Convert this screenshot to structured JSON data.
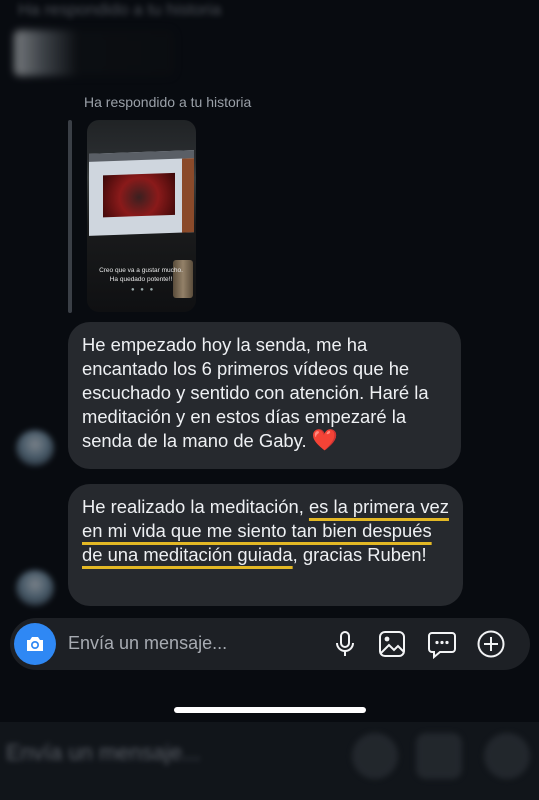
{
  "header": {
    "blurred_text": "Ha respondido a tu historia"
  },
  "reply": {
    "label": "Ha respondido a tu historia",
    "story_caption": "Creo que va a gustar mucho.\nHa quedado potente!!"
  },
  "messages": [
    {
      "id": "msg1",
      "parts": [
        "He empezado hoy la senda, me ha encantado los 6 primeros vídeos que he escuchado y sentido con atención. Haré la meditación y en estos días empezaré la senda de la mano de Gaby. "
      ],
      "emoji": "❤️"
    },
    {
      "id": "msg2",
      "part_plain_1": "He realizado la meditación, ",
      "part_underlined": "es la primera vez en mi vida que me siento tan bien después de una meditación guiada",
      "part_plain_2": ", gracias Ruben!"
    }
  ],
  "composer": {
    "placeholder": "Envía un mensaje...",
    "icons": [
      "camera-icon",
      "microphone-icon",
      "gallery-icon",
      "sticker-icon",
      "plus-icon"
    ],
    "accent": "#2f88f4"
  },
  "lower_blurred": {
    "text": "Envía un mensaje..."
  },
  "colors": {
    "background": "#080b10",
    "bubble": "#26292e",
    "underline": "#e3b825",
    "heart": "#e32929"
  }
}
